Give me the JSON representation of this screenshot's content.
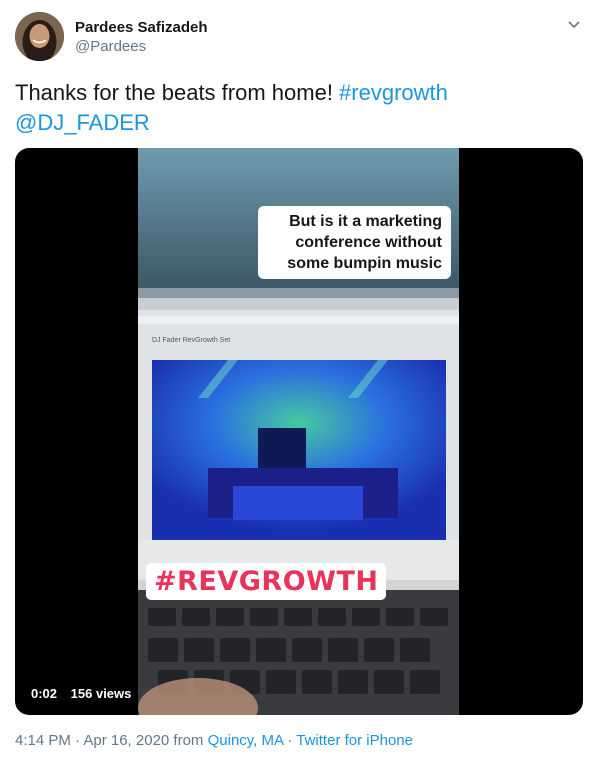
{
  "author": {
    "display_name": "Pardees Safizadeh",
    "handle": "@Pardees"
  },
  "tweet": {
    "text_prefix": "Thanks for the beats from home! ",
    "hashtag": "#revgrowth",
    "mention": "@DJ_FADER"
  },
  "video": {
    "caption": "But is it a marketing conference without some bumpin music",
    "screen_title": "DJ Fader RevGrowth Set",
    "sticker": "#REVGROWTH",
    "time": "0:02",
    "views": "156 views"
  },
  "footer": {
    "timestamp": "4:14 PM · Apr 16, 2020 from ",
    "location": "Quincy, MA",
    "separator": " · ",
    "source": "Twitter for iPhone"
  },
  "colors": {
    "link": "#1b95e0",
    "muted": "#657786",
    "sticker_text": "#e8345a"
  }
}
